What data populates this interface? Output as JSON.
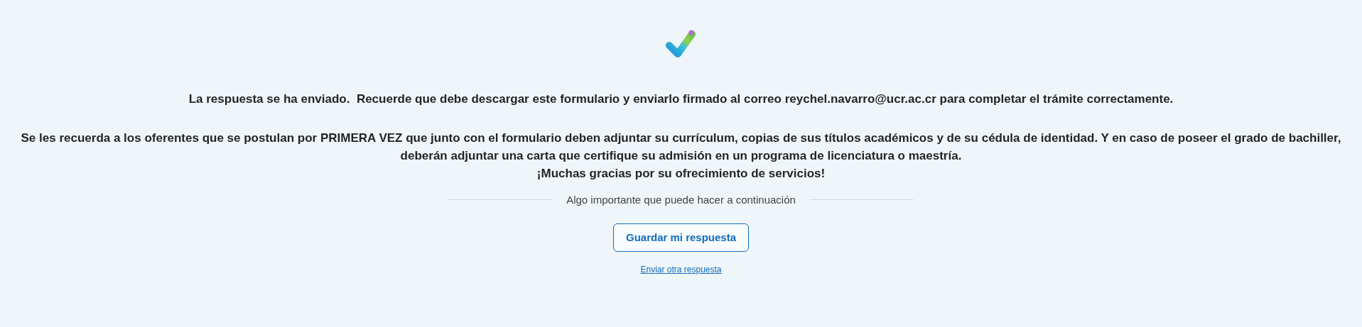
{
  "message": "La respuesta se ha enviado.  Recuerde que debe descargar este formulario y enviarlo firmado al correo reychel.navarro@ucr.ac.cr para completar el trámite correctamente.",
  "notice": "Se les recuerda a los oferentes que se postulan por **PRIMERA VEZ** que junto con el formulario deben adjuntar su currículum, copias de sus títulos académicos y de su cédula de identidad. Y en caso de poseer el grado de bachiller, deberán adjuntar una carta que certifique su admisión en un programa de licenciatura o maestría.",
  "thanks": "¡Muchas gracias por su ofrecimiento de servicios!",
  "divider_label": "Algo importante que puede hacer a continuación",
  "save_button": "Guardar mi respuesta",
  "another_link": "Enviar otra respuesta"
}
